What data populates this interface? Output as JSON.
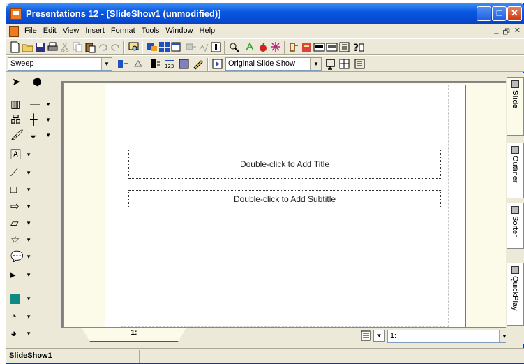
{
  "window": {
    "title": "Presentations 12 - [SlideShow1 (unmodified)]",
    "minimize_glyph": "_",
    "maximize_glyph": "□",
    "close_glyph": "✕"
  },
  "menu": {
    "items": [
      "File",
      "Edit",
      "View",
      "Insert",
      "Format",
      "Tools",
      "Window",
      "Help"
    ],
    "doc_minimize": "_",
    "doc_restore": "🗗",
    "doc_close": "✕"
  },
  "toolbar2": {
    "master_value": "Sweep",
    "slideshow_value": "Original Slide Show"
  },
  "slide": {
    "title_placeholder": "Double-click to Add Title",
    "subtitle_placeholder": "Double-click to Add Subtitle"
  },
  "slide_tab": {
    "label": "1:"
  },
  "slide_selector": {
    "value": "1:"
  },
  "right_tabs": [
    "Slide",
    "Outliner",
    "Sorter",
    "QuickPlay"
  ],
  "status": {
    "document": "SlideShow1"
  },
  "colors": {
    "accent_blue": "#0a58e0",
    "pasteboard": "#fcfae8"
  }
}
